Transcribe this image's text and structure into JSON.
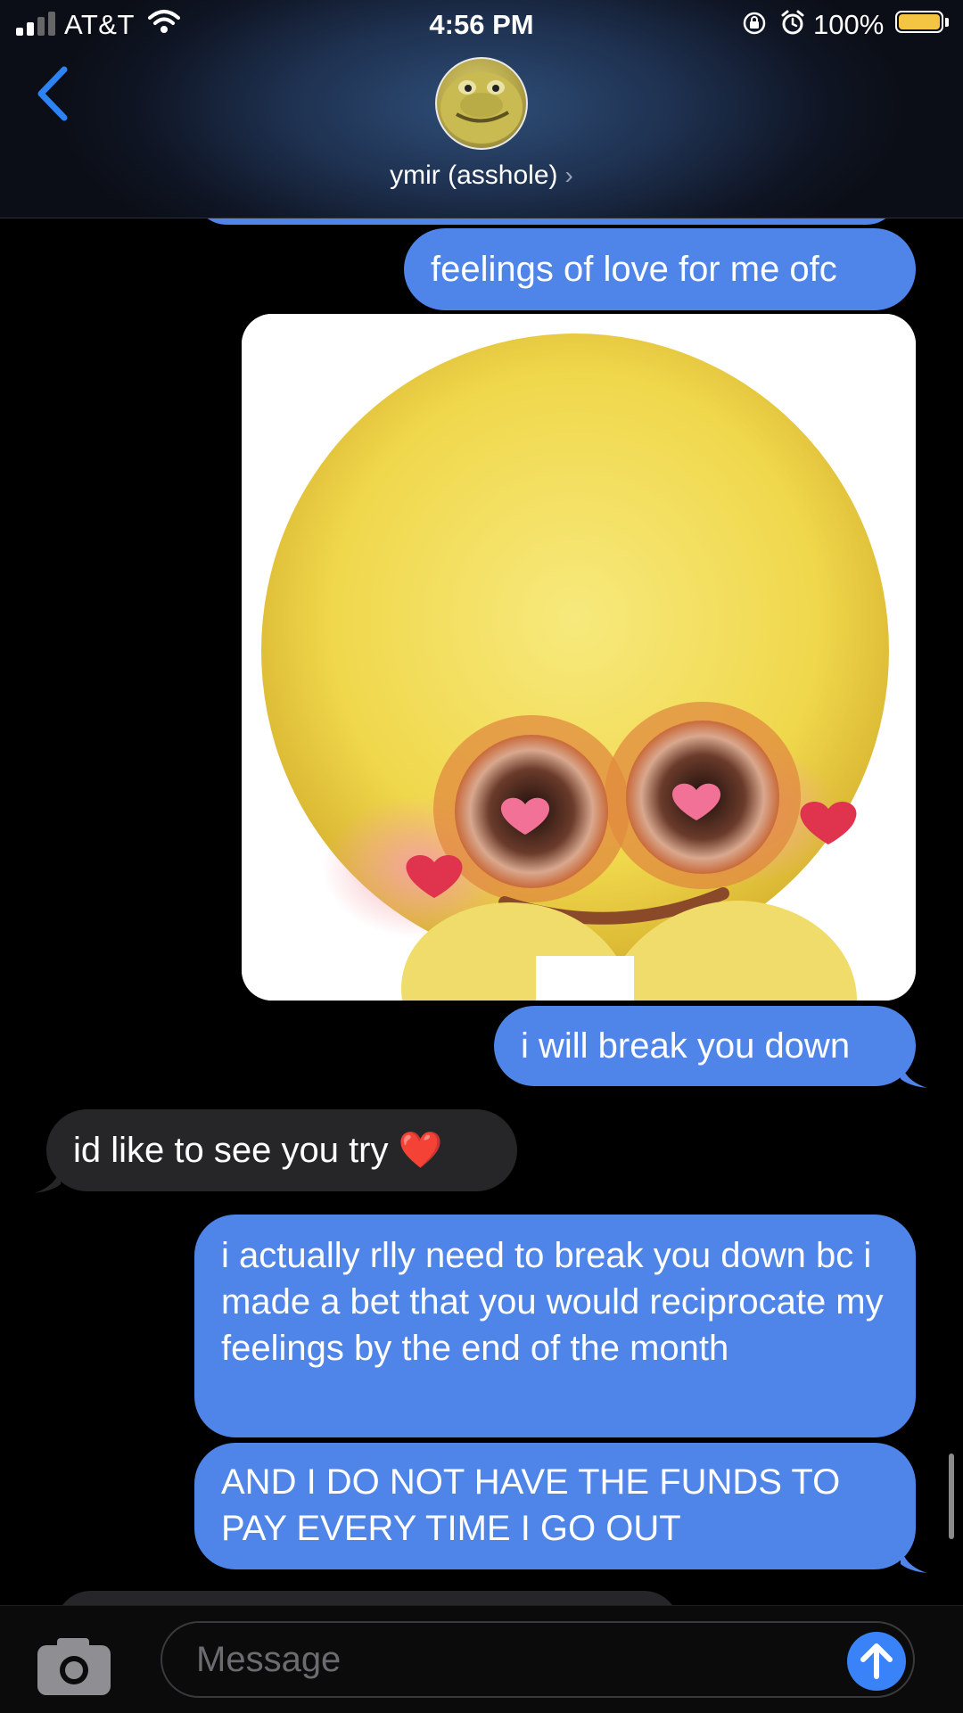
{
  "status_bar": {
    "carrier": "AT&T",
    "time": "4:56 PM",
    "battery": "100%",
    "battery_color": "#F4C542"
  },
  "header": {
    "back_icon": "chevron-left-icon",
    "contact_name": "ymir (asshole)",
    "contact_chevron": "›",
    "accent": "#2D82F6"
  },
  "messages": [
    {
      "direction": "sent",
      "text": "feelings of love for me ofc"
    },
    {
      "direction": "sent",
      "type": "image",
      "description_icon": "heart-eyes-emoji-image"
    },
    {
      "direction": "sent",
      "text": "i will break you down"
    },
    {
      "direction": "received",
      "text": "id like to see you try ❤️"
    },
    {
      "direction": "sent",
      "text": "i actually rlly need to break you down bc i made a bet that you would reciprocate my feelings by the end of the month"
    },
    {
      "direction": "sent",
      "text": "AND I DO NOT HAVE THE FUNDS TO PAY EVERY TIME I GO OUT"
    }
  ],
  "colors": {
    "sent_bubble": "#4F84E8",
    "received_bubble": "#262629"
  },
  "input": {
    "placeholder": "Message",
    "camera_icon": "camera-icon",
    "send_icon": "arrow-up-icon"
  }
}
